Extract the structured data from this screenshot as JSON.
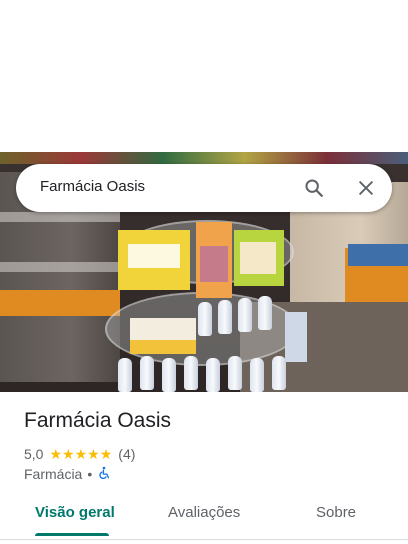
{
  "search": {
    "query": "Farmácia Oasis"
  },
  "place": {
    "name": "Farmácia Oasis",
    "rating": "5,0",
    "stars": 5,
    "review_count": "(4)",
    "category": "Farmácia",
    "separator": "•"
  },
  "tabs": [
    {
      "label": "Visão geral",
      "active": true
    },
    {
      "label": "Avaliações",
      "active": false
    },
    {
      "label": "Sobre",
      "active": false
    }
  ],
  "icons": {
    "search": "search-icon",
    "close": "close-icon",
    "accessibility": "wheelchair-icon",
    "star": "star-icon"
  },
  "colors": {
    "accent": "#00796b",
    "star": "#fbbc04",
    "accessibility": "#1a73e8"
  }
}
